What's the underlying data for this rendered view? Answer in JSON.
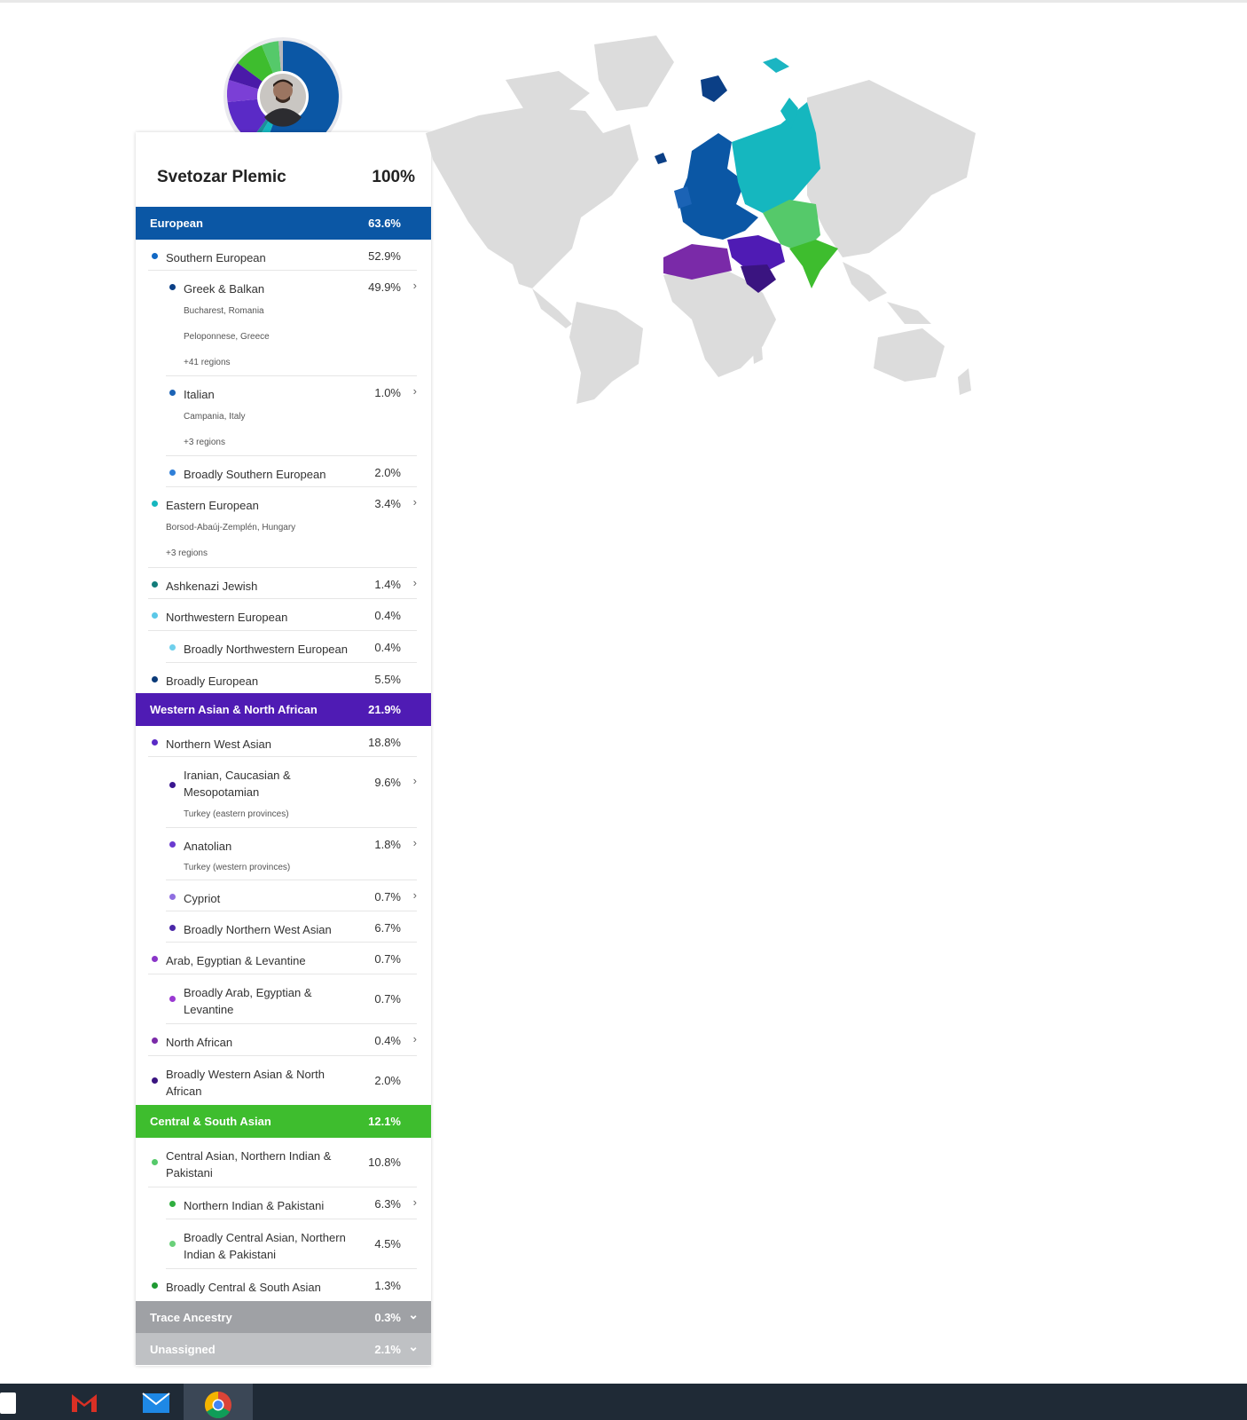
{
  "person": {
    "name": "Svetozar Plemic",
    "total": "100%"
  },
  "groups": {
    "european": {
      "label": "European",
      "value": "63.6%"
    },
    "western_asian": {
      "label": "Western Asian & North African",
      "value": "21.9%"
    },
    "central_south": {
      "label": "Central & South Asian",
      "value": "12.1%"
    },
    "trace": {
      "label": "Trace Ancestry",
      "value": "0.3%"
    },
    "unassigned": {
      "label": "Unassigned",
      "value": "2.1%"
    }
  },
  "rows": {
    "southern_european": {
      "label": "Southern European",
      "value": "52.9%"
    },
    "greek_balkan": {
      "label": "Greek & Balkan",
      "value": "49.9%",
      "subs": [
        "Bucharest, Romania",
        "Peloponnese, Greece",
        "+41 regions"
      ]
    },
    "italian": {
      "label": "Italian",
      "value": "1.0%",
      "subs": [
        "Campania, Italy",
        "+3 regions"
      ]
    },
    "broadly_southern": {
      "label": "Broadly Southern European",
      "value": "2.0%"
    },
    "eastern_european": {
      "label": "Eastern European",
      "value": "3.4%",
      "subs": [
        "Borsod-Abaúj-Zemplén, Hungary",
        "+3 regions"
      ]
    },
    "ashkenazi": {
      "label": "Ashkenazi Jewish",
      "value": "1.4%"
    },
    "northwestern": {
      "label": "Northwestern European",
      "value": "0.4%"
    },
    "broadly_northwestern": {
      "label": "Broadly Northwestern European",
      "value": "0.4%"
    },
    "broadly_european": {
      "label": "Broadly European",
      "value": "5.5%"
    },
    "northern_west_asian": {
      "label": "Northern West Asian",
      "value": "18.8%"
    },
    "iranian": {
      "label": "Iranian, Caucasian & Mesopotamian",
      "value": "9.6%",
      "subs": [
        "Turkey (eastern provinces)"
      ]
    },
    "anatolian": {
      "label": "Anatolian",
      "value": "1.8%",
      "subs": [
        "Turkey (western provinces)"
      ]
    },
    "cypriot": {
      "label": "Cypriot",
      "value": "0.7%"
    },
    "broadly_nwa": {
      "label": "Broadly Northern West Asian",
      "value": "6.7%"
    },
    "arab": {
      "label": "Arab, Egyptian & Levantine",
      "value": "0.7%"
    },
    "broadly_arab": {
      "label": "Broadly Arab, Egyptian & Levantine",
      "value": "0.7%"
    },
    "north_african": {
      "label": "North African",
      "value": "0.4%"
    },
    "broadly_wana": {
      "label": "Broadly Western Asian & North African",
      "value": "2.0%"
    },
    "central_asian_ni_pak": {
      "label": "Central Asian, Northern Indian & Pakistani",
      "value": "10.8%"
    },
    "northern_indian_pak": {
      "label": "Northern Indian & Pakistani",
      "value": "6.3%"
    },
    "broadly_central_asian": {
      "label": "Broadly Central Asian, Northern Indian & Pakistani",
      "value": "4.5%"
    },
    "broadly_central_south": {
      "label": "Broadly Central & South Asian",
      "value": "1.3%"
    }
  },
  "icons": {
    "chevron_right": "›",
    "chevron_down": "⌄"
  },
  "colors": {
    "european": "#0b57a5",
    "western_asian": "#4f1bb4",
    "central_south": "#3ebd2e",
    "trace": "#9fa1a5",
    "unassigned": "#bfc1c4",
    "eastern_european": "#15b7bf",
    "northwestern": "#5bc8e8",
    "taskbar": "#1f2a36"
  }
}
